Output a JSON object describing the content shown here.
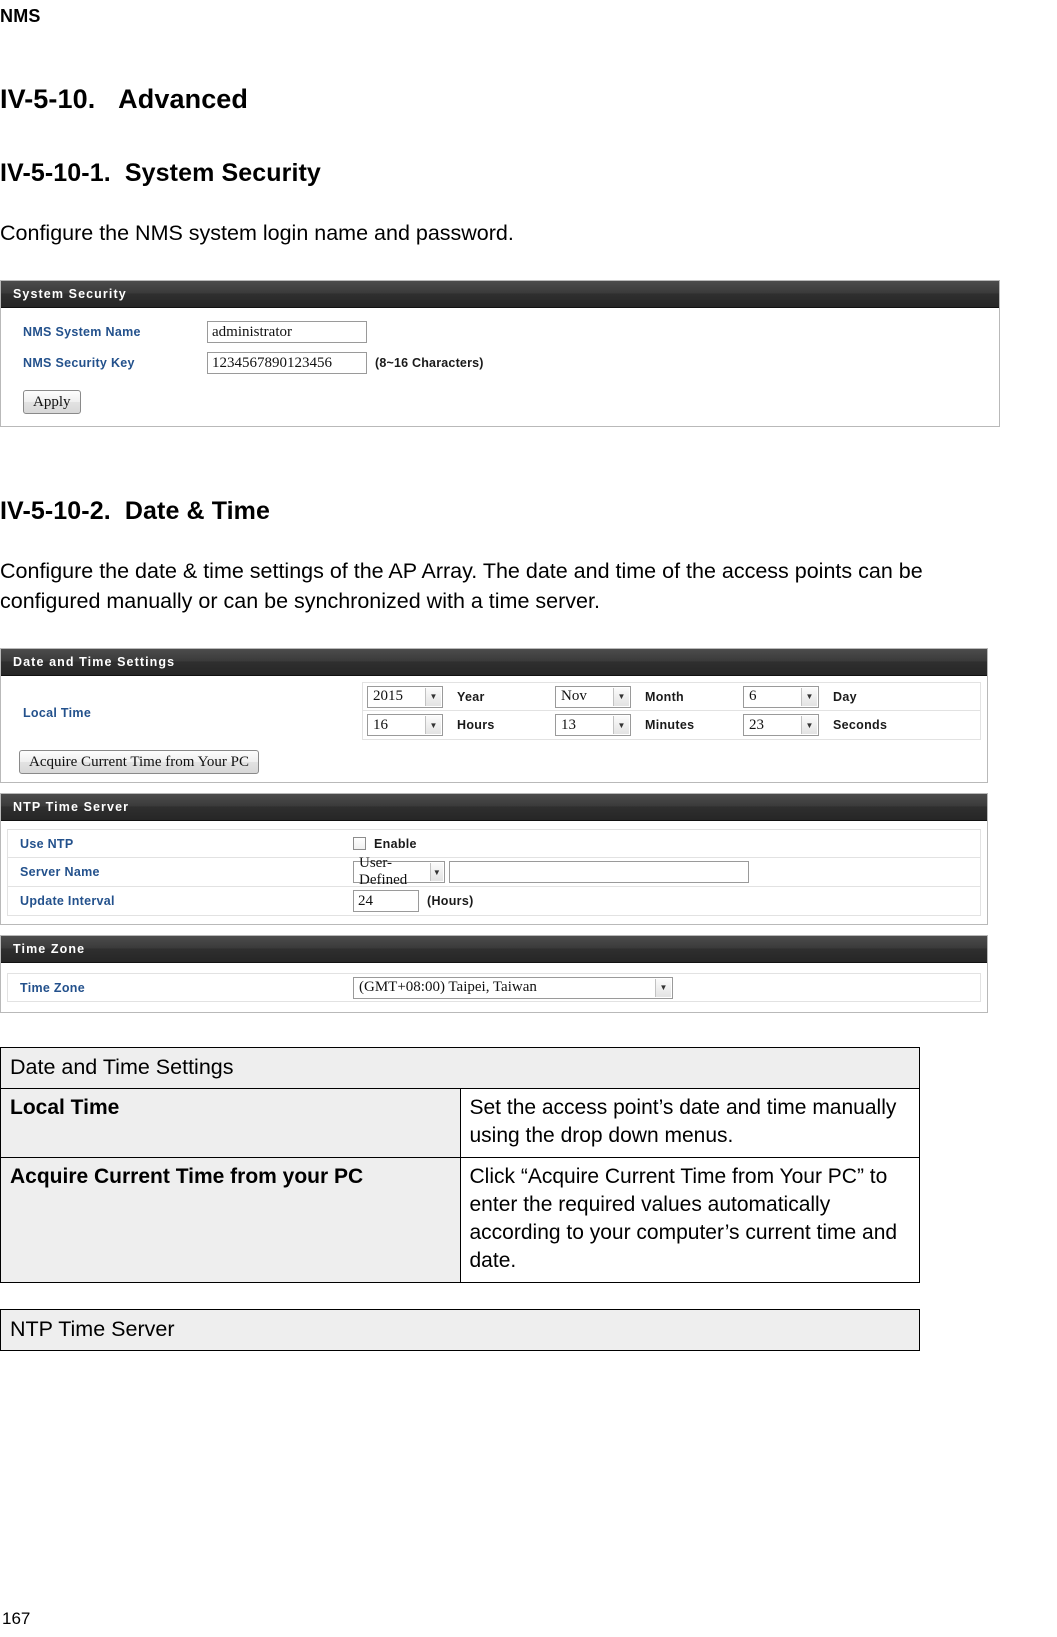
{
  "document": {
    "header": "NMS",
    "page_number": "167"
  },
  "sections": {
    "advanced": {
      "number": "IV-5-10.",
      "title": "Advanced"
    },
    "system_security": {
      "number": "IV-5-10-1.",
      "title": "System Security",
      "description": "Configure the NMS system login name and password."
    },
    "date_time": {
      "number": "IV-5-10-2.",
      "title": "Date & Time",
      "description": "Configure the date & time settings of the AP Array. The date and time of the access points can be configured manually or can be synchronized with a time server."
    }
  },
  "system_security_panel": {
    "title": "System Security",
    "fields": [
      {
        "label": "NMS System Name",
        "value": "administrator",
        "note": ""
      },
      {
        "label": "NMS Security Key",
        "value": "1234567890123456",
        "note": "(8~16 Characters)"
      }
    ],
    "apply_button": "Apply"
  },
  "date_time_panel": {
    "title": "Date and Time Settings",
    "local_time_label": "Local Time",
    "row1": [
      {
        "value": "2015",
        "name": "Year"
      },
      {
        "value": "Nov",
        "name": "Month"
      },
      {
        "value": "6",
        "name": "Day"
      }
    ],
    "row2": [
      {
        "value": "16",
        "name": "Hours"
      },
      {
        "value": "13",
        "name": "Minutes"
      },
      {
        "value": "23",
        "name": "Seconds"
      }
    ],
    "acquire_button": "Acquire Current Time from Your PC"
  },
  "ntp_panel": {
    "title": "NTP Time Server",
    "use_ntp_label": "Use NTP",
    "enable_label": "Enable",
    "server_name_label": "Server Name",
    "server_name_value": "User-Defined",
    "server_name_text": "",
    "update_interval_label": "Update Interval",
    "update_interval_value": "24",
    "update_interval_unit": "(Hours)"
  },
  "timezone_panel": {
    "title": "Time Zone",
    "label": "Time Zone",
    "value": "(GMT+08:00) Taipei, Taiwan"
  },
  "tables": {
    "date_time": {
      "header": "Date and Time Settings",
      "rows": [
        {
          "key": "Local Time",
          "value": "Set the access point’s date and time manually using the drop down menus."
        },
        {
          "key": "Acquire Current Time from your PC",
          "value": "Click “Acquire Current Time from Your PC” to enter the required values automatically according to your computer’s current time and date."
        }
      ]
    },
    "ntp": {
      "header": "NTP Time Server"
    }
  }
}
